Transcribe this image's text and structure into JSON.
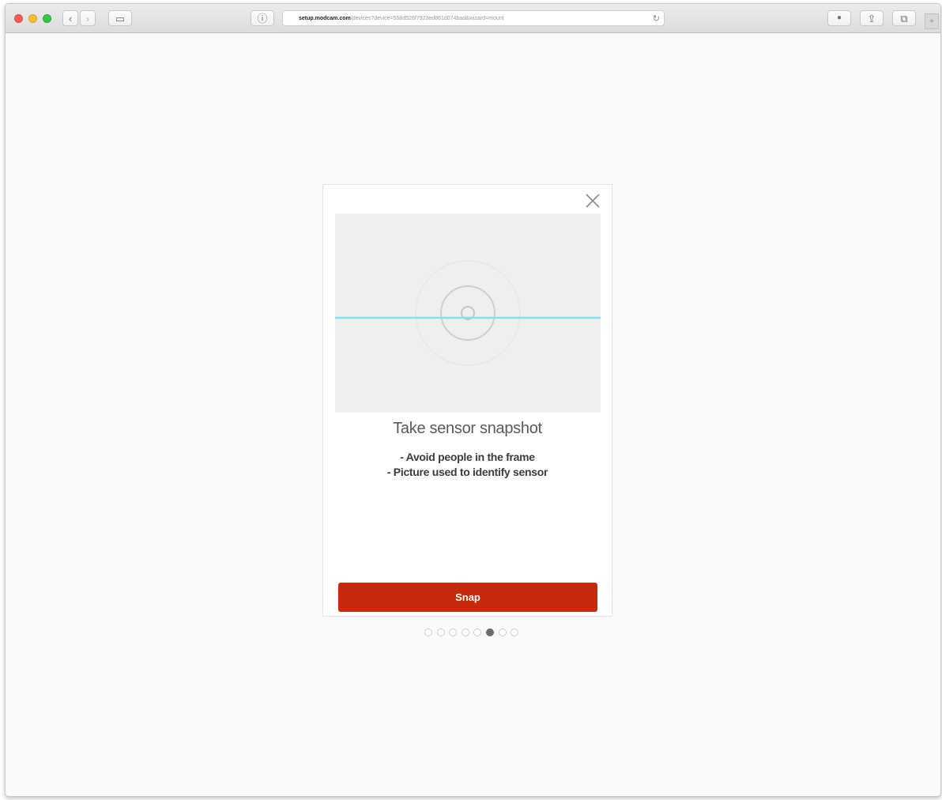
{
  "browser": {
    "url_host": "setup.modcam.com",
    "url_path": "/devices?device=558d526f7923ed861d074bad&wizard=mount",
    "buttons": {
      "back": "‹",
      "forward": "›",
      "sidebar": "▭",
      "info": "ⓘ",
      "reload": "↻",
      "downloads": "●",
      "share": "⇪",
      "tabs": "⧉",
      "new_tab": "+"
    }
  },
  "modal": {
    "title": "Take sensor snapshot",
    "tips": [
      "- Avoid people in the frame",
      "- Picture used to identify sensor"
    ],
    "snap_label": "Snap"
  },
  "pager": {
    "total": 8,
    "active_index": 5
  },
  "colors": {
    "accent": "#c62a0c",
    "scan_line": "#7fe3ea",
    "preview_bg": "#efefef"
  }
}
